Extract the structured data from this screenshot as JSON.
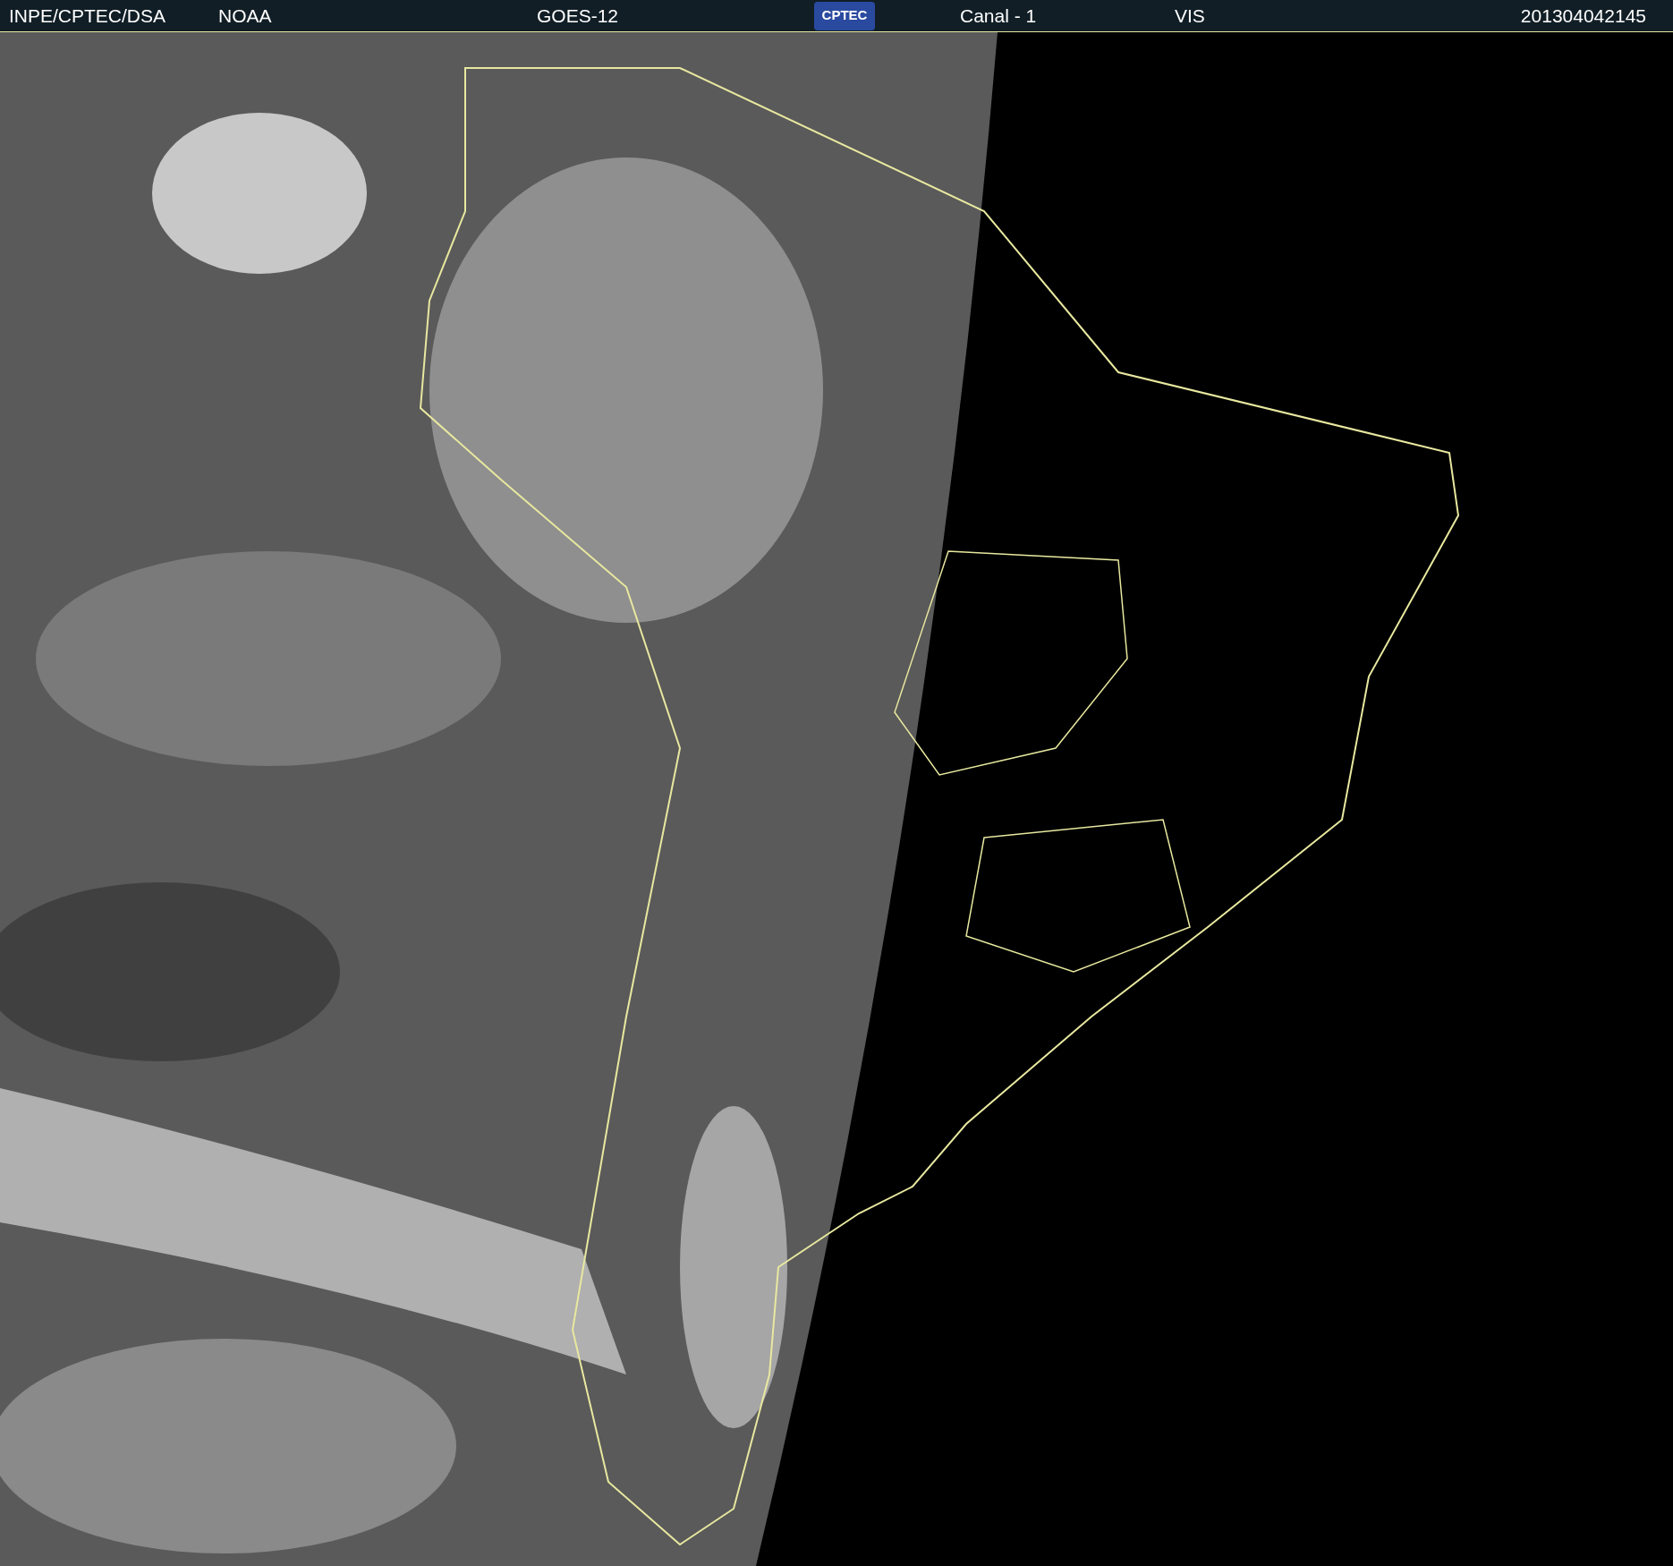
{
  "header": {
    "source": "INPE/CPTEC/DSA",
    "agency": "NOAA",
    "satellite": "GOES-12",
    "logo": "CPTEC",
    "channel": "Canal - 1",
    "band": "VIS",
    "timestamp": "201304042145"
  }
}
